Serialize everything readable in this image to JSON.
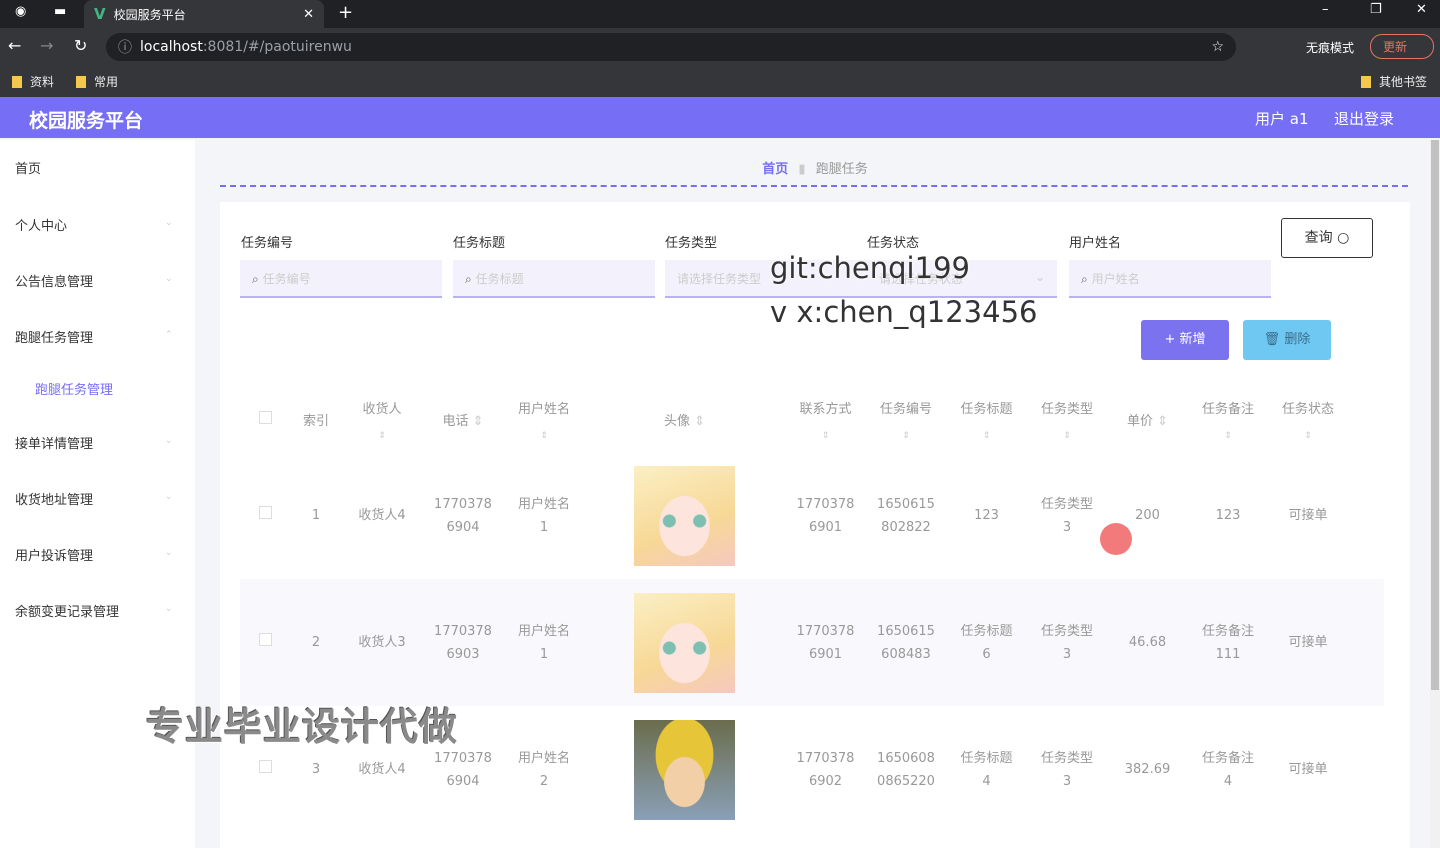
{
  "browser": {
    "tab_title": "校园服务平台",
    "url_host": "localhost",
    "url_rest": ":8081/#/paotuirenwu",
    "incognito": "无痕模式",
    "update": "更新",
    "bookmarks": [
      "资料",
      "常用"
    ],
    "other_bookmarks": "其他书签"
  },
  "header": {
    "title": "校园服务平台",
    "user": "用户 a1",
    "logout": "退出登录"
  },
  "sidebar": {
    "items": [
      "首页",
      "个人中心",
      "公告信息管理",
      "跑腿任务管理",
      "跑腿任务管理",
      "接单详情管理",
      "收货地址管理",
      "用户投诉管理",
      "余额变更记录管理"
    ]
  },
  "breadcrumb": {
    "home": "首页",
    "current": "跑腿任务"
  },
  "search": {
    "fields": [
      {
        "label": "任务编号",
        "placeholder": "任务编号"
      },
      {
        "label": "任务标题",
        "placeholder": "任务标题"
      },
      {
        "label": "任务类型",
        "placeholder": "请选择任务类型"
      },
      {
        "label": "任务状态",
        "placeholder": "请选择任务状态"
      },
      {
        "label": "用户姓名",
        "placeholder": "用户姓名"
      }
    ],
    "query": "查询",
    "add": "+ 新增",
    "delete": "删除"
  },
  "table": {
    "headers": [
      "索引",
      "收货人",
      "电话",
      "用户姓名",
      "头像",
      "联系方式",
      "任务编号",
      "任务标题",
      "任务类型",
      "单价",
      "任务备注",
      "任务状态"
    ],
    "rows": [
      {
        "idx": "1",
        "receiver": "收货人4",
        "phone": "17703786904",
        "user": "用户姓名1",
        "contact": "17703786901",
        "no": "1650615802822",
        "title": "123",
        "type": "任务类型3",
        "price": "200",
        "note": "123",
        "status": "可接单"
      },
      {
        "idx": "2",
        "receiver": "收货人3",
        "phone": "17703786903",
        "user": "用户姓名1",
        "contact": "17703786901",
        "no": "1650615608483",
        "title": "任务标题6",
        "type": "任务类型3",
        "price": "46.68",
        "note": "任务备注111",
        "status": "可接单"
      },
      {
        "idx": "3",
        "receiver": "收货人4",
        "phone": "17703786904",
        "user": "用户姓名2",
        "contact": "17703786902",
        "no": "16506080865220",
        "title": "任务标题4",
        "type": "任务类型3",
        "price": "382.69",
        "note": "任务备注4",
        "status": "可接单"
      }
    ]
  },
  "watermark": {
    "line1": "git:chenqi199",
    "line2": "v x:chen_q123456",
    "promo": "专业毕业设计代做"
  },
  "colors": {
    "accent": "#766ef5",
    "add": "#7b72f0",
    "delete": "#6fc8f2"
  }
}
